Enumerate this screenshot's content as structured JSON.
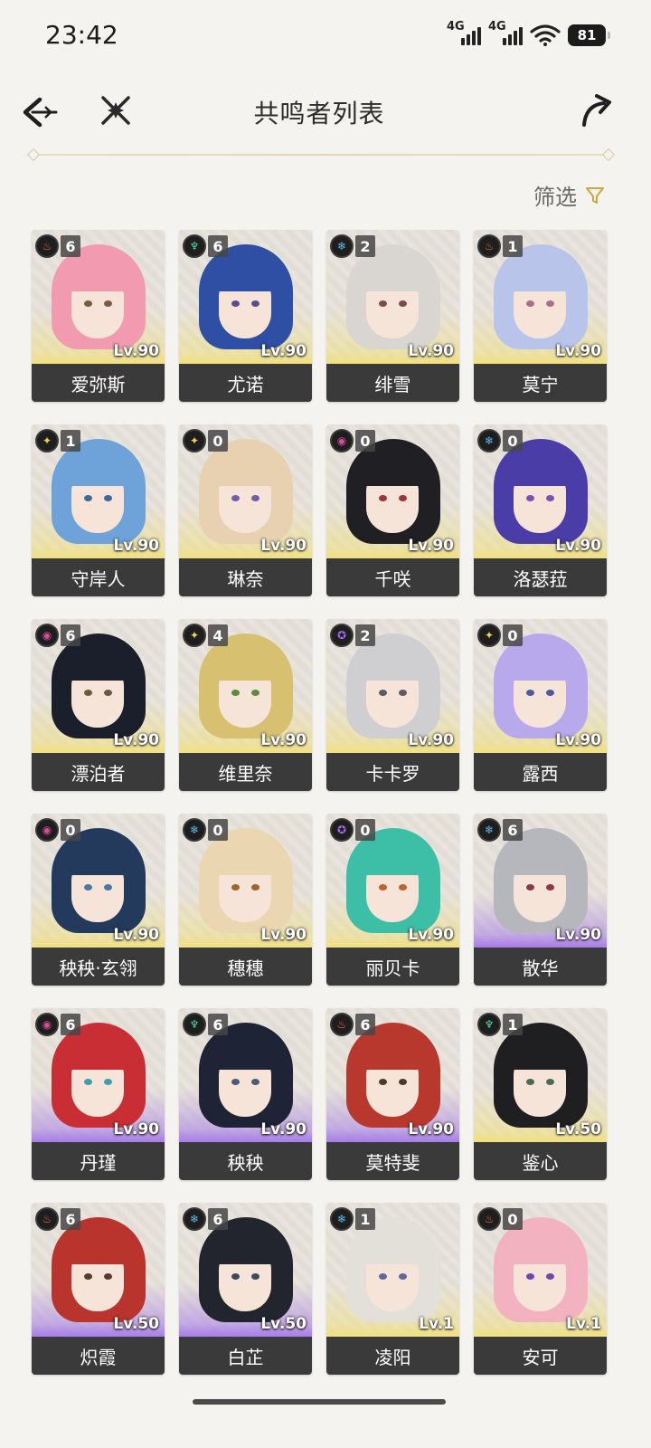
{
  "status": {
    "time": "23:42",
    "net1": "4G",
    "net2": "4G",
    "battery": "81"
  },
  "header": {
    "title": "共鸣者列表"
  },
  "filter": {
    "label": "筛选"
  },
  "colors": {
    "gold": "#f1e07e",
    "purple": "#a77de8",
    "nameBar": "#3a3a3a",
    "filterIcon": "#c9a93c"
  },
  "characters": [
    {
      "name": "爱弥斯",
      "rank": "6",
      "level": "Lv.90",
      "element": "fusion",
      "tier": "gold",
      "hair": "#f29bb0",
      "eye": "#7a5b3d"
    },
    {
      "name": "尤诺",
      "rank": "6",
      "level": "Lv.90",
      "element": "aero",
      "tier": "gold",
      "hair": "#2e4fa3",
      "eye": "#5a4f8a"
    },
    {
      "name": "绯雪",
      "rank": "2",
      "level": "Lv.90",
      "element": "glacio",
      "tier": "gold",
      "hair": "#d9d6d2",
      "eye": "#7b4a4a"
    },
    {
      "name": "莫宁",
      "rank": "1",
      "level": "Lv.90",
      "element": "fusion",
      "tier": "gold",
      "hair": "#b9c4ea",
      "eye": "#b06a8a"
    },
    {
      "name": "守岸人",
      "rank": "1",
      "level": "Lv.90",
      "element": "spectro",
      "tier": "gold",
      "hair": "#6da3d8",
      "eye": "#3d6a9a"
    },
    {
      "name": "琳奈",
      "rank": "0",
      "level": "Lv.90",
      "element": "spectro",
      "tier": "gold",
      "hair": "#e8d1b0",
      "eye": "#6e5ea8"
    },
    {
      "name": "千咲",
      "rank": "0",
      "level": "Lv.90",
      "element": "havoc",
      "tier": "gold",
      "hair": "#1f1f24",
      "eye": "#a0323a"
    },
    {
      "name": "洛瑟菈",
      "rank": "0",
      "level": "Lv.90",
      "element": "glacio",
      "tier": "gold",
      "hair": "#4b3da8",
      "eye": "#7d4fb0"
    },
    {
      "name": "漂泊者",
      "rank": "6",
      "level": "Lv.90",
      "element": "havoc",
      "tier": "gold",
      "hair": "#1b1f2b",
      "eye": "#6b5a3a"
    },
    {
      "name": "维里奈",
      "rank": "4",
      "level": "Lv.90",
      "element": "spectro",
      "tier": "gold",
      "hair": "#d8c071",
      "eye": "#5e8a3a"
    },
    {
      "name": "卡卡罗",
      "rank": "2",
      "level": "Lv.90",
      "element": "electro",
      "tier": "gold",
      "hair": "#cfcfd2",
      "eye": "#5a5a6a"
    },
    {
      "name": "露西",
      "rank": "0",
      "level": "Lv.90",
      "element": "spectro",
      "tier": "gold",
      "hair": "#b8a9ec",
      "eye": "#4a5aa0"
    },
    {
      "name": "秧秧·玄翎",
      "rank": "0",
      "level": "Lv.90",
      "element": "havoc",
      "tier": "gold",
      "hair": "#243a5c",
      "eye": "#4a78a8"
    },
    {
      "name": "穗穗",
      "rank": "0",
      "level": "Lv.90",
      "element": "glacio",
      "tier": "gold",
      "hair": "#ead7b2",
      "eye": "#a0652a"
    },
    {
      "name": "丽贝卡",
      "rank": "0",
      "level": "Lv.90",
      "element": "electro",
      "tier": "gold",
      "hair": "#3cbfa6",
      "eye": "#c0602a"
    },
    {
      "name": "散华",
      "rank": "6",
      "level": "Lv.90",
      "element": "glacio",
      "tier": "purple",
      "hair": "#b6b6bd",
      "eye": "#8a3a4a"
    },
    {
      "name": "丹瑾",
      "rank": "6",
      "level": "Lv.90",
      "element": "havoc",
      "tier": "purple",
      "hair": "#c92e35",
      "eye": "#3aa0a8"
    },
    {
      "name": "秧秧",
      "rank": "6",
      "level": "Lv.90",
      "element": "aero",
      "tier": "purple",
      "hair": "#1e2336",
      "eye": "#4a5a7a"
    },
    {
      "name": "莫特斐",
      "rank": "6",
      "level": "Lv.90",
      "element": "fusion",
      "tier": "purple",
      "hair": "#b8382e",
      "eye": "#4a3a2a"
    },
    {
      "name": "鉴心",
      "rank": "1",
      "level": "Lv.50",
      "element": "aero",
      "tier": "gold",
      "hair": "#1f1f22",
      "eye": "#4a6a5a"
    },
    {
      "name": "炽霞",
      "rank": "6",
      "level": "Lv.50",
      "element": "fusion",
      "tier": "purple",
      "hair": "#b8342c",
      "eye": "#5a3a2a"
    },
    {
      "name": "白芷",
      "rank": "6",
      "level": "Lv.50",
      "element": "glacio",
      "tier": "purple",
      "hair": "#22252d",
      "eye": "#3a4a5a"
    },
    {
      "name": "凌阳",
      "rank": "1",
      "level": "Lv.1",
      "element": "glacio",
      "tier": "gold",
      "hair": "#e3e0da",
      "eye": "#5a6aa0"
    },
    {
      "name": "安可",
      "rank": "0",
      "level": "Lv.1",
      "element": "fusion",
      "tier": "gold",
      "hair": "#f2b2bf",
      "eye": "#6a4ab0"
    }
  ]
}
